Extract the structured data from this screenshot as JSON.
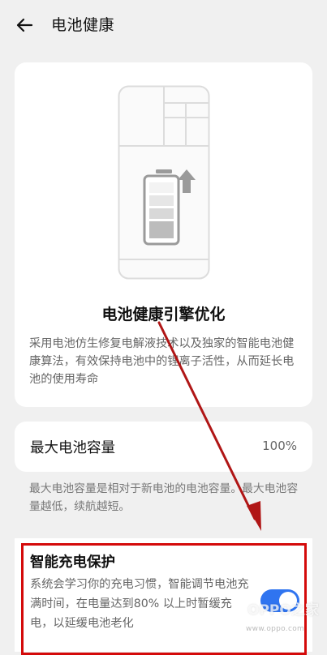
{
  "header": {
    "title": "电池健康",
    "back_icon": "arrow-left-icon"
  },
  "hero": {
    "illustration_icon": "battery-charging-icon",
    "title": "电池健康引擎优化",
    "description": "采用电池仿生修复电解液技术以及独家的智能电池健康算法，有效保持电池中的锂离子活性，从而延长电池的使用寿命"
  },
  "capacity": {
    "label": "最大电池容量",
    "value": "100%",
    "note": "最大电池容量是相对于新电池的电池容量。最大电池容量越低，续航越短。"
  },
  "smart_charge": {
    "title": "智能充电保护",
    "description": "系统会学习你的充电习惯，智能调节电池充满时间，在电量达到80% 以上时暂缓充电，以延缓电池老化",
    "enabled": true
  },
  "watermark": {
    "brand": "OPPO之家",
    "url": "www.oppo.com"
  },
  "colors": {
    "background": "#f0f0f0",
    "card": "#ffffff",
    "accent": "#2f74f0",
    "annotation_red": "#d40a0a"
  }
}
